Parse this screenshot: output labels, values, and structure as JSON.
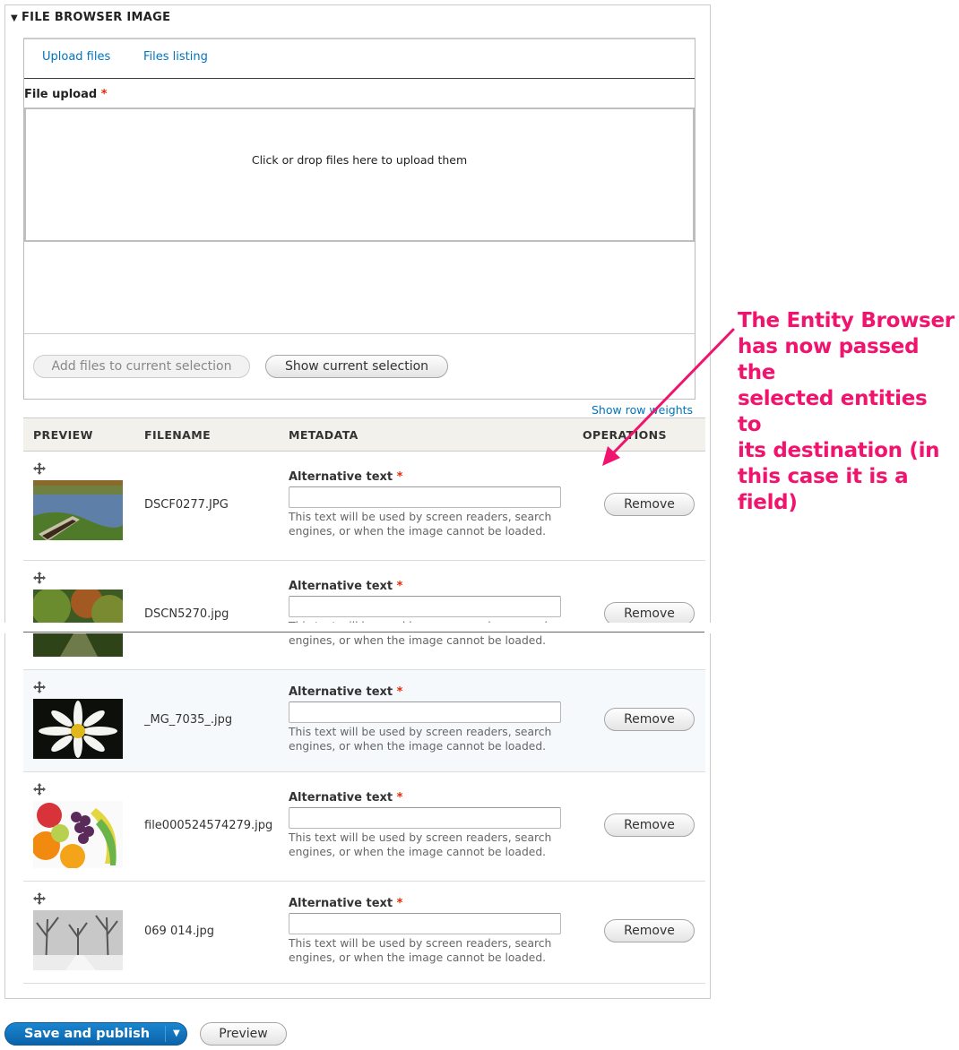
{
  "fieldset": {
    "title": "FILE BROWSER IMAGE"
  },
  "tabs": {
    "upload": "Upload files",
    "listing": "Files listing"
  },
  "upload": {
    "label": "File upload",
    "required_mark": "*",
    "dropzone_text": "Click or drop files here to upload them"
  },
  "actions": {
    "add_files": "Add files to current selection",
    "show_selection": "Show current selection"
  },
  "table": {
    "show_weights": "Show row weights",
    "headers": [
      "PREVIEW",
      "FILENAME",
      "METADATA",
      "OPERATIONS"
    ],
    "alt_label": "Alternative text",
    "alt_desc_line1": "This text will be used by screen readers, search",
    "alt_desc_line2": "engines, or when the image cannot be loaded.",
    "remove_label": "Remove",
    "rows": [
      {
        "filename": "DSCF0277.JPG"
      },
      {
        "filename": "DSCN5270.jpg"
      },
      {
        "filename": "_MG_7035_.jpg"
      },
      {
        "filename": "file000524574279.jpg"
      },
      {
        "filename": "069 014.jpg"
      }
    ]
  },
  "footer": {
    "save": "Save and publish",
    "preview": "Preview"
  },
  "annotation": {
    "lines": [
      "The Entity Browser",
      "has now passed the",
      "selected entities to",
      "its destination (in",
      "this case it is a field)"
    ],
    "color": "#f0146e"
  },
  "colors": {
    "link": "#0074bd",
    "primary": "#0a63aa",
    "required": "#e62600"
  }
}
